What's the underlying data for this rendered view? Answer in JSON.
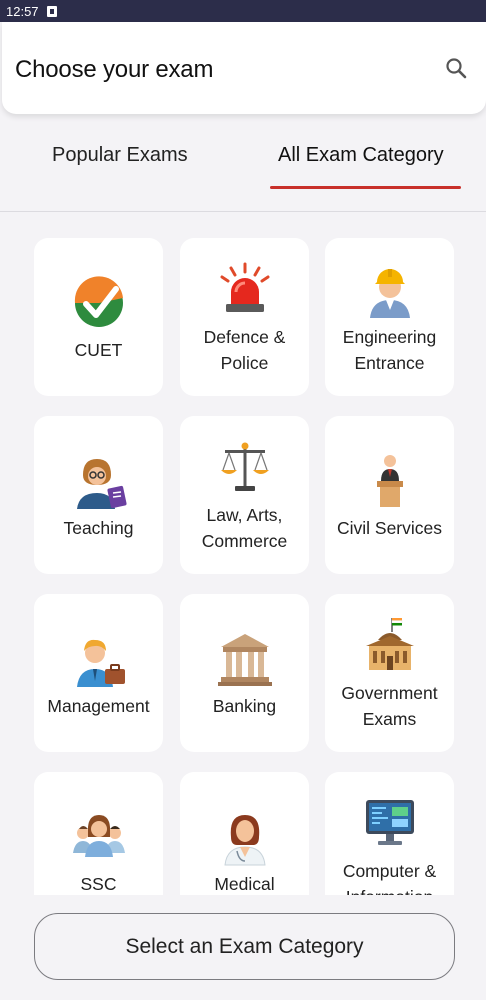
{
  "status": {
    "time": "12:57"
  },
  "header": {
    "title": "Choose your exam"
  },
  "tabs": [
    {
      "label": "Popular Exams",
      "active": false
    },
    {
      "label": "All Exam Category",
      "active": true
    }
  ],
  "colors": {
    "accent": "#c8302a",
    "status_bar": "#2c2d4a",
    "card": "#ffffff",
    "background": "#f4f3f6"
  },
  "categories": [
    {
      "label": "CUET",
      "icon": "cuet-check-icon"
    },
    {
      "label": "Defence &\nPolice",
      "icon": "siren-icon"
    },
    {
      "label": "Engineering\nEntrance",
      "icon": "engineer-icon"
    },
    {
      "label": "Teaching",
      "icon": "teacher-icon"
    },
    {
      "label": "Law, Arts,\nCommerce",
      "icon": "scales-icon"
    },
    {
      "label": "Civil Services",
      "icon": "podium-icon"
    },
    {
      "label": "Management",
      "icon": "manager-icon"
    },
    {
      "label": "Banking",
      "icon": "bank-icon"
    },
    {
      "label": "Government\nExams",
      "icon": "government-building-icon"
    },
    {
      "label": "SSC",
      "icon": "group-icon"
    },
    {
      "label": "Medical",
      "icon": "doctor-icon"
    },
    {
      "label": "Computer &\nInformation",
      "icon": "computer-icon"
    }
  ],
  "cta": {
    "label": "Select an Exam Category"
  }
}
